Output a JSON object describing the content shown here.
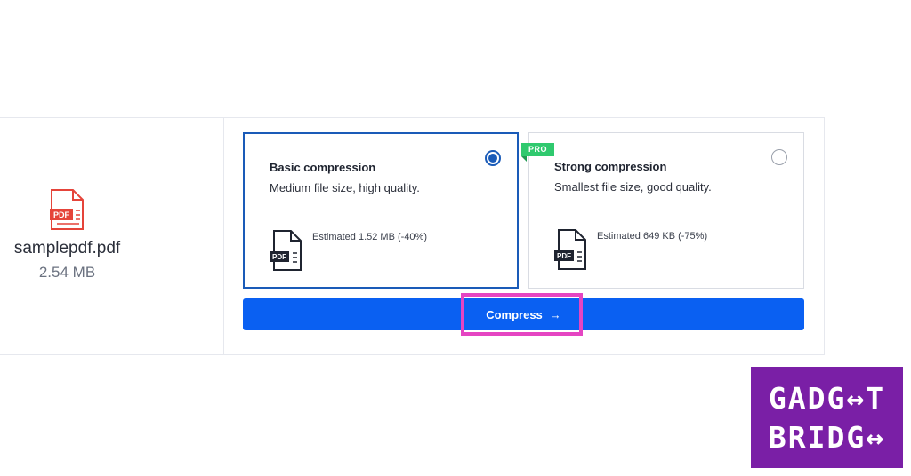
{
  "file": {
    "name": "samplepdf.pdf",
    "size": "2.54 MB",
    "icon": "pdf-file-icon",
    "icon_label": "PDF"
  },
  "options": [
    {
      "title": "Basic compression",
      "description": "Medium file size, high quality.",
      "estimate": "Estimated 1.52 MB (-40%)",
      "selected": true
    },
    {
      "title": "Strong compression",
      "description": "Smallest file size, good quality.",
      "estimate": "Estimated 649 KB (-75%)",
      "selected": false,
      "badge": "PRO"
    }
  ],
  "compress_button": {
    "label": "Compress",
    "arrow": "→"
  },
  "watermark": {
    "line1": "GADG↔T",
    "line2": "BRIDG↔"
  },
  "colors": {
    "primary": "#0a60f2",
    "selected_border": "#1a5bb8",
    "pro_badge": "#2fc96e",
    "pdf_red": "#e5443a",
    "highlight": "#e545c2",
    "logo_bg": "#7a1fa6"
  }
}
